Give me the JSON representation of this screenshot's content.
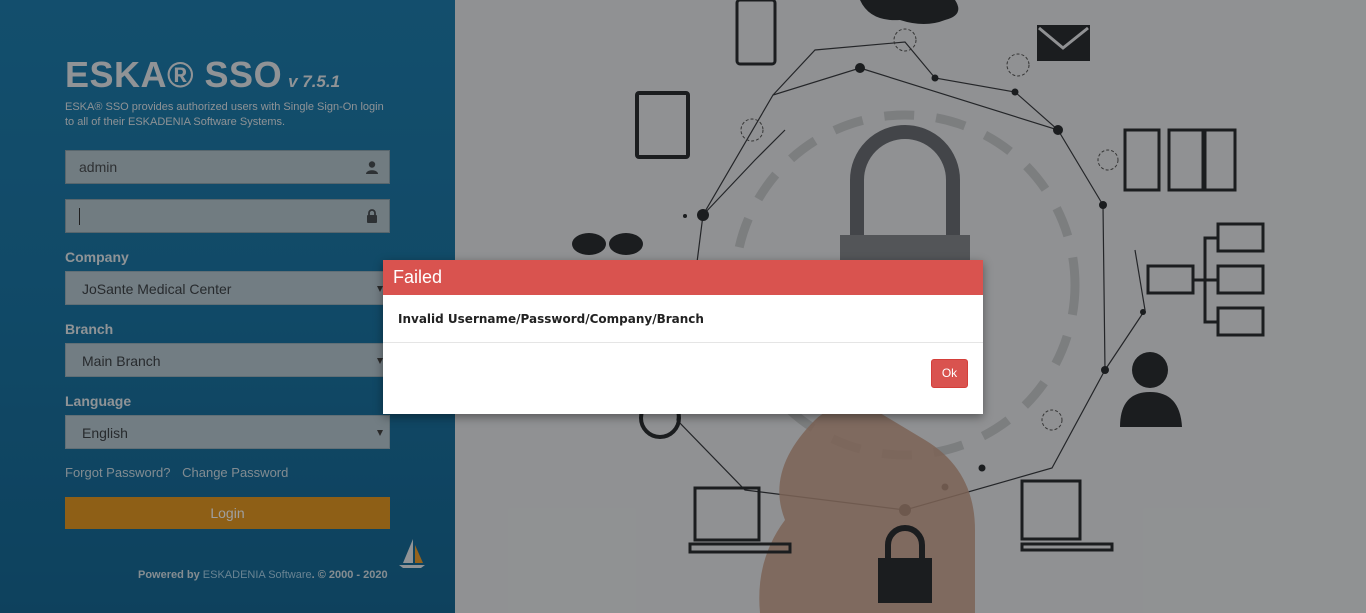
{
  "brand": {
    "name": "ESKA® SSO",
    "version": "v 7.5.1",
    "description": "ESKA® SSO provides authorized users with Single Sign-On login to all of their ESKADENIA Software Systems."
  },
  "form": {
    "username_value": "admin",
    "password_value": "",
    "company_label": "Company",
    "company_value": "JoSante Medical Center",
    "branch_label": "Branch",
    "branch_value": "Main Branch",
    "language_label": "Language",
    "language_value": "English",
    "forgot_password": "Forgot Password?",
    "change_password": "Change Password",
    "login_label": "Login"
  },
  "footer": {
    "prefix": "Powered by ",
    "company": "ESKADENIA Software",
    "suffix": ". © 2000 - 2020"
  },
  "dialog": {
    "title": "Failed",
    "message": "Invalid Username/Password/Company/Branch",
    "ok_label": "Ok"
  },
  "colors": {
    "panel": "#1f7fb0",
    "login_button": "#e59a24",
    "dialog_header": "#d9534f"
  },
  "icons": [
    "user-icon",
    "lock-icon",
    "padlock-icon",
    "envelope-icon",
    "server-icon",
    "monitor-icon",
    "person-icon",
    "laptop-icon",
    "tablet-icon",
    "phone-icon",
    "cloud-icon",
    "sailboat-icon"
  ]
}
